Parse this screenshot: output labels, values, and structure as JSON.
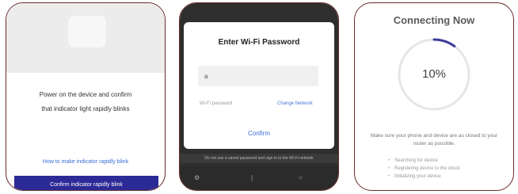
{
  "screen1": {
    "instruction_line1": "Power on the device and confirm",
    "instruction_line2": "that indicator light rapidly blinks",
    "help_link": "How to make indicator rapidly blink",
    "confirm_button": "Confirm indicator rapidly blink"
  },
  "screen2": {
    "dialog_title": "Enter Wi-Fi Password",
    "password_value": "a",
    "password_hint": "Wi-Fi password",
    "change_network": "Change Network",
    "confirm": "Confirm",
    "keyboard_hint": "Do not use a saved password and sign in to the Wi-Fi network"
  },
  "screen3": {
    "title": "Connecting Now",
    "progress_percent": "10%",
    "progress_fraction": 0.1,
    "note": "Make sure your phone and device are as closed to your router as possible.",
    "steps": [
      "Searching for device",
      "Registering device to the cloud",
      "Initializing your device"
    ]
  },
  "colors": {
    "accent": "#2b2a96",
    "link": "#3a6fd8",
    "border": "#6b2a2a",
    "ring": "#3b3a9a"
  }
}
